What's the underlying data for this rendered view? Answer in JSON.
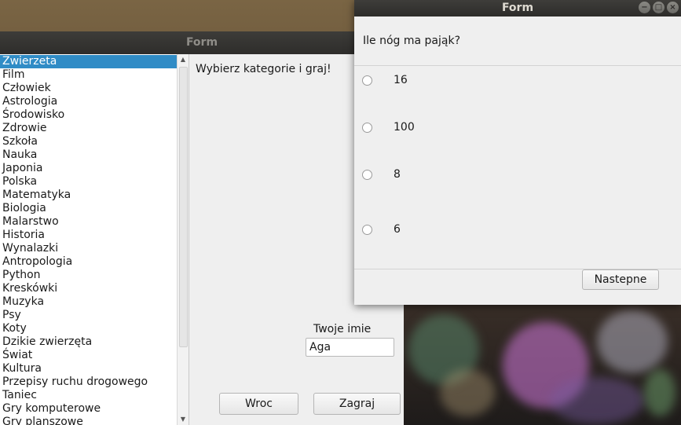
{
  "main_window": {
    "title": "Form",
    "categories": [
      "Zwierzeta",
      "Film",
      "Człowiek",
      "Astrologia",
      "Środowisko",
      "Zdrowie",
      "Szkoła",
      "Nauka",
      "Japonia",
      "Polska",
      "Matematyka",
      "Biologia",
      "Malarstwo",
      "Historia",
      "Wynalazki",
      "Antropologia",
      "Python",
      "Kreskówki",
      "Muzyka",
      "Psy",
      "Koty",
      "Dzikie zwierzęta",
      "Świat",
      "Kultura",
      "Przepisy ruchu drogowego",
      "Taniec",
      "Gry komputerowe",
      "Gry planszowe"
    ],
    "selected_category": "Zwierzeta",
    "prompt": "Wybierz kategorie i graj!",
    "name_label": "Twoje imie",
    "name_value": "Aga",
    "back_button": "Wroc",
    "play_button": "Zagraj"
  },
  "quiz_window": {
    "title": "Form",
    "question": "Ile nóg ma pająk?",
    "options": [
      "16",
      "100",
      "8",
      "6"
    ],
    "next_button": "Nastepne"
  },
  "icons": {
    "scroll_up": "chevron-up-icon",
    "scroll_down": "chevron-down-icon",
    "minimize": "minimize-icon",
    "maximize": "maximize-icon",
    "close": "close-icon"
  },
  "colors": {
    "selection": "#308cc6",
    "titlebar": "#2e2d2b"
  }
}
